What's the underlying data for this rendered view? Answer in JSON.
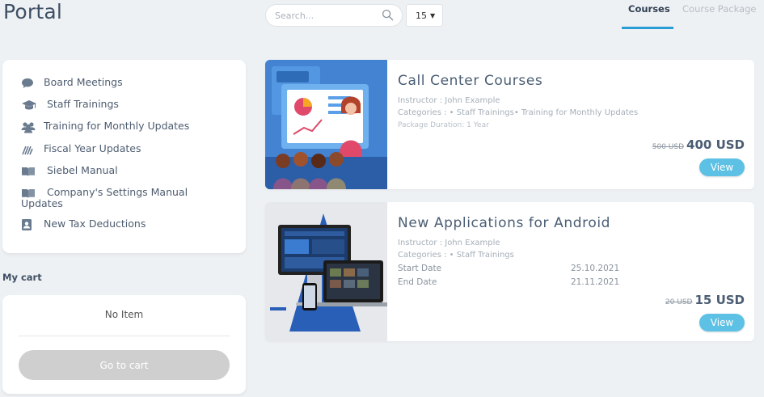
{
  "header": {
    "app_title": "Portal",
    "search_placeholder": "Search...",
    "page_size": "15",
    "tabs": [
      {
        "label": "Courses",
        "active": true
      },
      {
        "label": "Course Package",
        "active": false
      }
    ],
    "accent_color": "#2a9ed4"
  },
  "sidebar": {
    "items": [
      {
        "label": "Board Meetings",
        "icon": "speech-bubble-icon"
      },
      {
        "label": "Staff Trainings",
        "icon": "graduation-cap-icon"
      },
      {
        "label": "Training for Monthly Updates",
        "icon": "users-icon"
      },
      {
        "label": "Fiscal Year Updates",
        "icon": "signal-waves-icon"
      },
      {
        "label": "Siebel Manual",
        "icon": "open-book-icon"
      },
      {
        "label": "Company's Settings Manual Updates",
        "icon": "open-book-icon"
      },
      {
        "label": "New Tax Deductions",
        "icon": "contact-card-icon"
      }
    ]
  },
  "cart": {
    "title": "My cart",
    "empty_text": "No Item",
    "button_label": "Go to cart"
  },
  "courses": [
    {
      "title": "Call Center Courses",
      "instructor": "Instructor : John Example",
      "categories": "Categories : • Staff Trainings• Training for Monthly Updates",
      "duration": "Package Duration: 1 Year",
      "old_price": "500 USD",
      "price": "400 USD",
      "button_label": "View"
    },
    {
      "title": "New Applications for Android",
      "instructor": "Instructor : John Example",
      "categories": "Categories : • Staff Trainings",
      "start_label": "Start Date",
      "start_value": "25.10.2021",
      "end_label": "End Date",
      "end_value": "21.11.2021",
      "old_price": "20 USD",
      "price": "15 USD",
      "button_label": "View"
    }
  ]
}
